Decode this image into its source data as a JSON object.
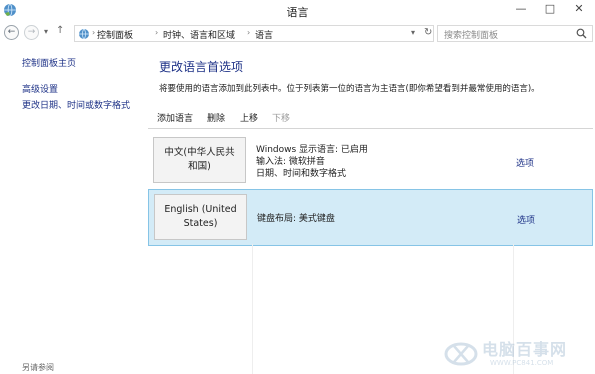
{
  "window": {
    "title": "语言"
  },
  "address": {
    "breadcrumbs": [
      "控制面板",
      "时钟、语言和区域",
      "语言"
    ],
    "search_placeholder": "搜索控制面板"
  },
  "sidebar": {
    "home_link": "控制面板主页",
    "links": [
      "高级设置",
      "更改日期、时间或数字格式"
    ],
    "see_also": "另请参阅"
  },
  "main": {
    "heading": "更改语言首选项",
    "description": "将要使用的语言添加到此列表中。位于列表第一位的语言为主语言(即你希望看到并最常使用的语言)。",
    "toolbar": {
      "add": "添加语言",
      "remove": "删除",
      "move_up": "上移",
      "move_down": "下移"
    },
    "languages": [
      {
        "name_line1": "中文(中华人民共",
        "name_line2": "和国)",
        "info1": "Windows 显示语言: 已启用",
        "info2": "输入法: 微软拼音",
        "info3": "日期、时间和数字格式",
        "options": "选项"
      },
      {
        "name_line1": "English (United",
        "name_line2": "States)",
        "info1": "键盘布局: 美式键盘",
        "options": "选项"
      }
    ]
  },
  "watermark": {
    "text": "电脑百事网",
    "url": "WWW.PC841.COM"
  },
  "icons": [
    "app-globe-icon",
    "back-arrow-icon",
    "forward-arrow-icon",
    "recent-dropdown-icon",
    "up-arrow-icon",
    "control-panel-icon",
    "search-icon",
    "minimize-icon",
    "maximize-icon",
    "close-icon"
  ]
}
